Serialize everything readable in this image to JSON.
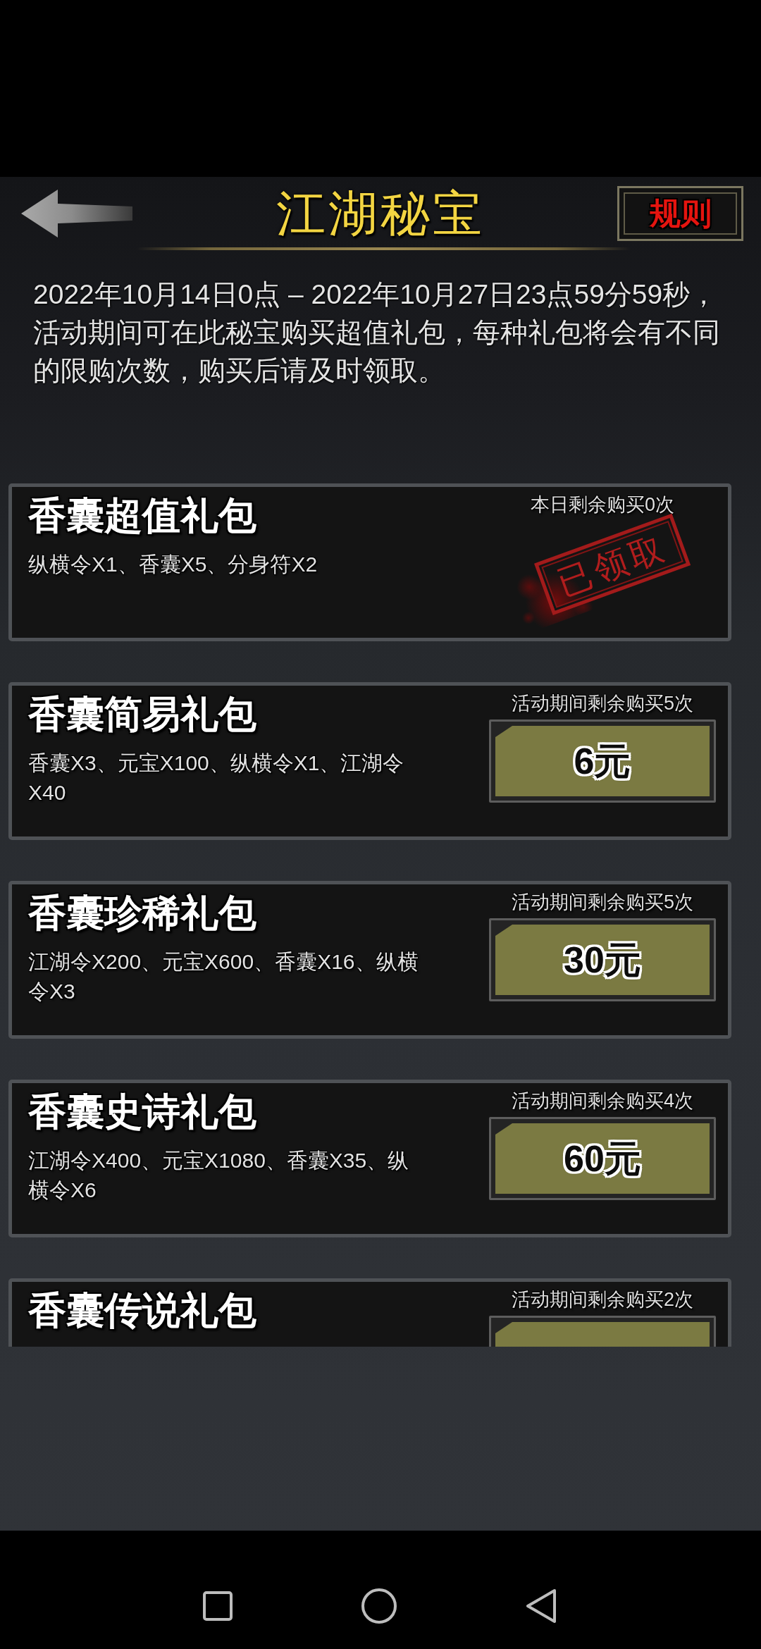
{
  "header": {
    "title": "江湖秘宝",
    "rules_button": "规则"
  },
  "intro": "2022年10月14日0点 – 2022年10月27日23点59分59秒，活动期间可在此秘宝购买超值礼包，每种礼包将会有不同的限购次数，购买后请及时领取。",
  "packs": [
    {
      "title": "香囊超值礼包",
      "contents": "纵横令X1、香囊X5、分身符X2",
      "limit": "本日剩余购买0次",
      "claimed": true,
      "stamp": "已领取"
    },
    {
      "title": "香囊简易礼包",
      "contents": "香囊X3、元宝X100、纵横令X1、江湖令X40",
      "limit": "活动期间剩余购买5次",
      "claimed": false,
      "price": "6元"
    },
    {
      "title": "香囊珍稀礼包",
      "contents": "江湖令X200、元宝X600、香囊X16、纵横令X3",
      "limit": "活动期间剩余购买5次",
      "claimed": false,
      "price": "30元"
    },
    {
      "title": "香囊史诗礼包",
      "contents": "江湖令X400、元宝X1080、香囊X35、纵横令X6",
      "limit": "活动期间剩余购买4次",
      "claimed": false,
      "price": "60元"
    },
    {
      "title": "香囊传说礼包",
      "limit": "活动期间剩余购买2次",
      "claimed": false
    }
  ]
}
